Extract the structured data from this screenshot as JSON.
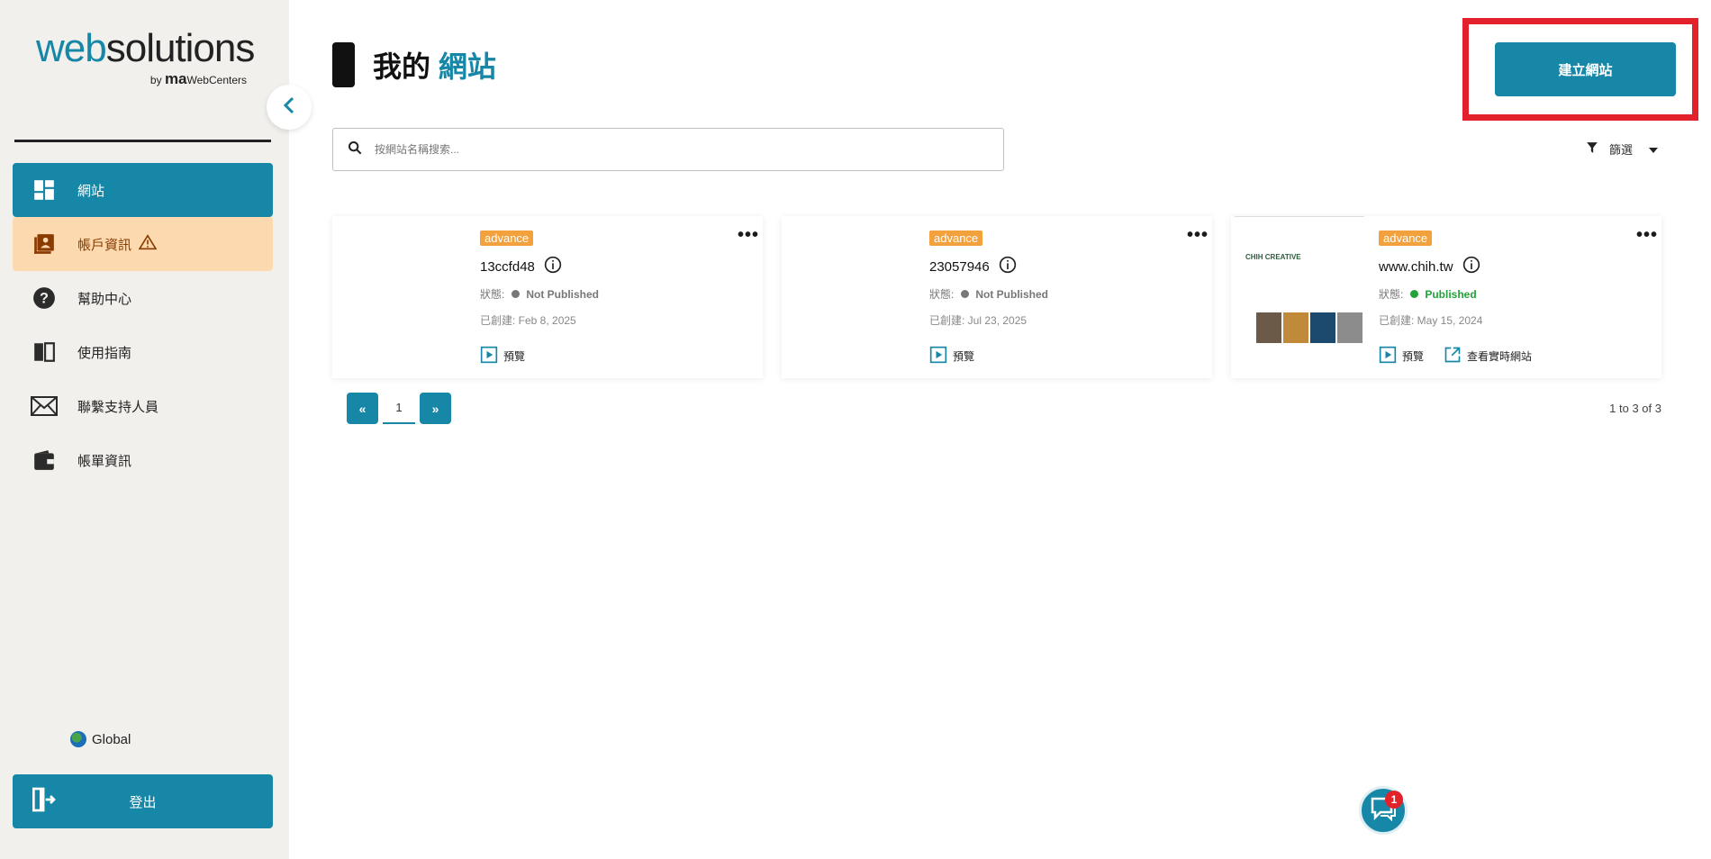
{
  "brand": {
    "logo_web": "web",
    "logo_solutions": "solutions",
    "logo_by": "by",
    "logo_ma": "ma",
    "logo_webcenters": "WebCenters"
  },
  "sidebar": {
    "items": [
      {
        "label": "網站",
        "icon": "dashboard-icon"
      },
      {
        "label": "帳戶資訊",
        "icon": "account-card-icon"
      },
      {
        "label": "幫助中心",
        "icon": "help-circle-icon"
      },
      {
        "label": "使用指南",
        "icon": "book-icon"
      },
      {
        "label": "聯繫支持人員",
        "icon": "mail-icon"
      },
      {
        "label": "帳單資訊",
        "icon": "wallet-icon"
      }
    ],
    "region_label": "Global",
    "logout_label": "登出"
  },
  "header": {
    "title_prefix": "我的",
    "title_highlight": "網站",
    "create_button": "建立網站"
  },
  "search": {
    "placeholder": "按網站名稱搜索..."
  },
  "filter": {
    "label": "篩選"
  },
  "sites": [
    {
      "plan": "advance",
      "name": "13ccfd48",
      "status_label": "狀態:",
      "status": "Not Published",
      "created": "已創建: Feb 8, 2025",
      "preview": "預覽"
    },
    {
      "plan": "advance",
      "name": "23057946",
      "status_label": "狀態:",
      "status": "Not Published",
      "created": "已創建: Jul 23, 2025",
      "preview": "預覽"
    },
    {
      "plan": "advance",
      "name": "www.chih.tw",
      "status_label": "狀態:",
      "status": "Published",
      "created": "已創建: May 15, 2024",
      "preview": "預覽",
      "view_live": "查看實時網站",
      "thumb_title": "CHIH CREATIVE"
    }
  ],
  "pagination": {
    "prev": "«",
    "page": "1",
    "next": "»",
    "range": "1 to 3 of 3"
  },
  "chat": {
    "badge": "1"
  },
  "colors": {
    "accent": "#1687a7",
    "warning_bg": "#fdd9b0",
    "badge": "#f2a13c",
    "published": "#22a33a",
    "highlight_frame": "#e2212b"
  }
}
